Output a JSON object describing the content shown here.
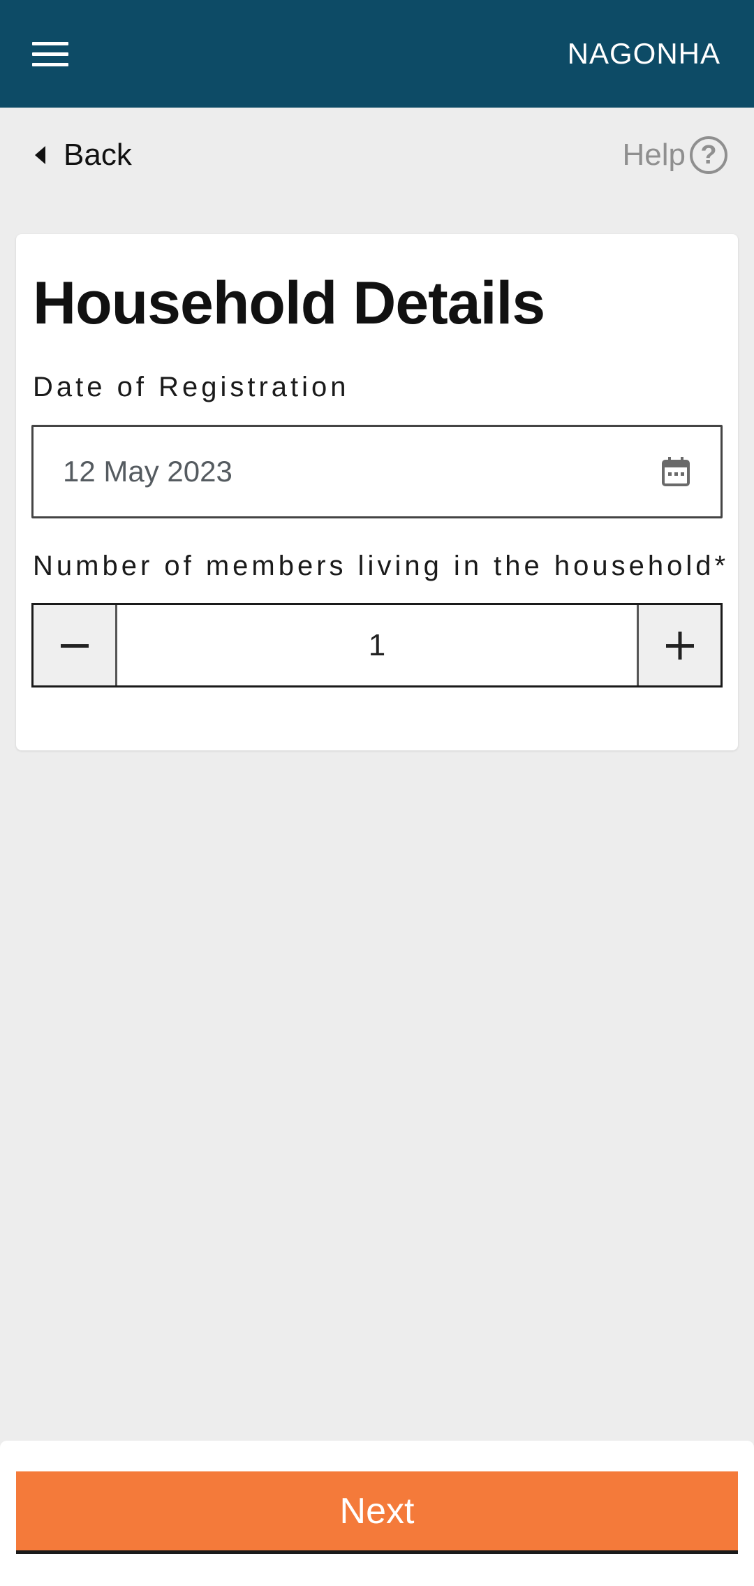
{
  "header": {
    "brand": "NAGONHA",
    "background_color": "#0d4b66",
    "menu_icon": "hamburger-icon"
  },
  "nav": {
    "back_label": "Back",
    "help_label": "Help",
    "help_icon_glyph": "?"
  },
  "form": {
    "title": "Household Details",
    "date_label": "Date of Registration",
    "date_value": "12 May 2023",
    "date_icon": "calendar-icon",
    "members_label": "Number of members living in the household*",
    "members_value": "1",
    "decrement_icon": "minus-icon",
    "increment_icon": "plus-icon"
  },
  "footer": {
    "next_label": "Next",
    "next_color": "#f47a3a"
  }
}
